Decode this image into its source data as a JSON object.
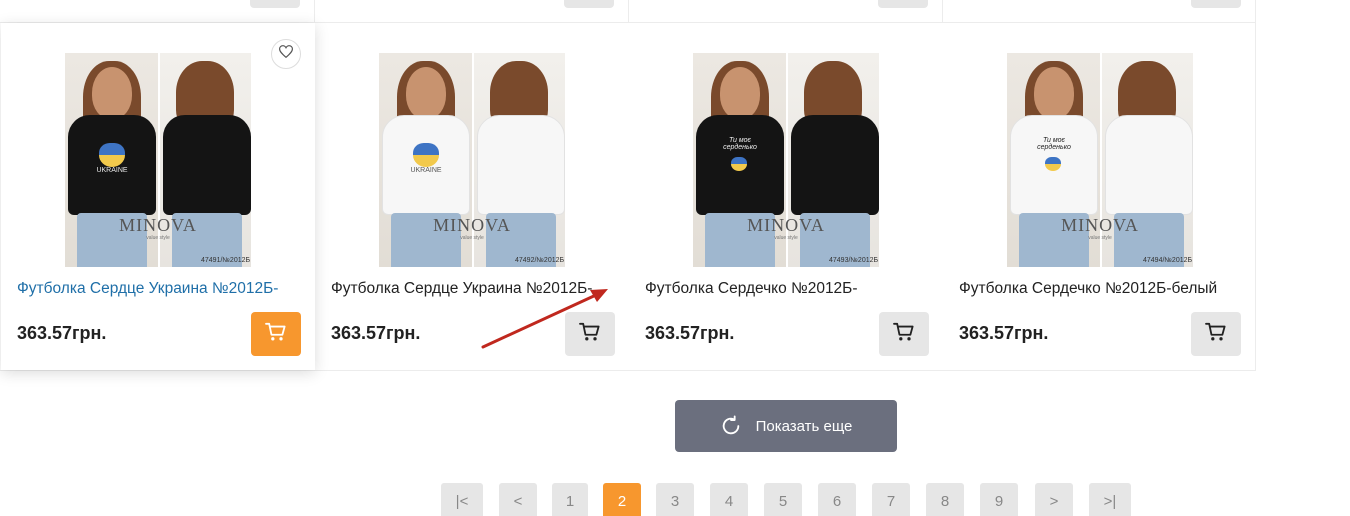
{
  "products": [
    {
      "title": "Футболка Сердце Украина №2012Б-",
      "price": "363.57грн.",
      "code": "47491/№2012Б",
      "brand": "MINOVA",
      "brand_sub": "value style",
      "shirt_color": "#141414",
      "print": "heart",
      "print_text": "UKRAINE"
    },
    {
      "title": "Футболка Сердце Украина №2012Б-",
      "price": "363.57грн.",
      "code": "47492/№2012Б",
      "brand": "MINOVA",
      "brand_sub": "value style",
      "shirt_color": "#f7f7f7",
      "print": "heart",
      "print_text": "UKRAINE"
    },
    {
      "title": "Футболка Сердечко №2012Б-",
      "price": "363.57грн.",
      "code": "47493/№2012Б",
      "brand": "MINOVA",
      "brand_sub": "value style",
      "shirt_color": "#141414",
      "print": "hands",
      "print_text": "Ти моє серденько"
    },
    {
      "title": "Футболка Сердечко №2012Б-белый",
      "price": "363.57грн.",
      "code": "47494/№2012Б",
      "brand": "MINOVA",
      "brand_sub": "value style",
      "shirt_color": "#f7f7f7",
      "print": "hands",
      "print_text": "Ти моє серденько"
    }
  ],
  "load_more": {
    "label": "Показать еще",
    "icon": "refresh-icon"
  },
  "pagination": {
    "first": "|<",
    "prev": "<",
    "pages": [
      "1",
      "2",
      "3",
      "4",
      "5",
      "6",
      "7",
      "8",
      "9"
    ],
    "current": "2",
    "next": ">",
    "last": ">|"
  },
  "colors": {
    "accent": "#f7972e",
    "link": "#1f6fa8",
    "button_gray": "#e6e6e6",
    "load_more_bg": "#6b6f7e",
    "annotation_arrow": "#c0281e"
  },
  "icons": {
    "wishlist": "heart-outline-icon",
    "cart": "shopping-cart-icon"
  }
}
